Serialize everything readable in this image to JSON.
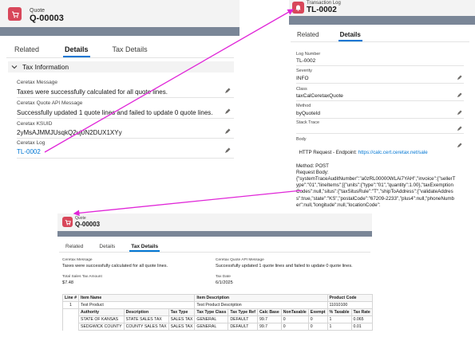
{
  "quote_panel": {
    "object_type": "Quote",
    "title": "Q-00003",
    "tabs": [
      "Related",
      "Details",
      "Tax Details"
    ],
    "active_tab": "Details",
    "section_title": "Tax Information",
    "fields": [
      {
        "label": "Ceretax Message",
        "value": "Taxes were successfully calculated for all quote lines."
      },
      {
        "label": "Ceretax Quote API Message",
        "value": "Successfully updated 1 quote lines and failed to update 0 quote lines."
      },
      {
        "label": "Ceretax KSUID",
        "value": "2yMsAJMMJUsqkQ2uj0N2DUX1XYy"
      },
      {
        "label": "Ceretax Log",
        "value": "TL-0002"
      }
    ]
  },
  "log_panel": {
    "object_type": "Transaction Log",
    "title": "TL-0002",
    "tabs": [
      "Related",
      "Details"
    ],
    "active_tab": "Details",
    "fields": [
      {
        "label": "Log Number",
        "value": "TL-0002"
      },
      {
        "label": "Severity",
        "value": "INFO"
      },
      {
        "label": "Class",
        "value": "taxCalCeretaxQuote"
      },
      {
        "label": "Method",
        "value": "byQuoteId"
      },
      {
        "label": "Stack Trace",
        "value": ""
      }
    ],
    "body_label": "Body",
    "body_endpoint_prefix": "HTTP Request - Endpoint: ",
    "body_endpoint_url": "https://calc.cert.ceretax.net/sale",
    "body_text": "Method: POST\nRequest Body:\n{\"systemTraceAuditNumber\":\"a0zRL00000WLAi7YAH\",\"invoice\":{\"sellerType\":\"01\",\"lineItems\":[{\"units\":{\"type\":\"01\",\"quantity\":1.00},\"taxExemptionCodes\":null,\"situs\":{\"taxSitusRule\":\"T\",\"shipToAddress\":{\"validateAddress\":true,\"state\":\"KS\",\"postalCode\":\"67209-2233\",\"plus4\":null,\"phoneNumber\":null,\"longitude\":null,\"locationCode\":"
  },
  "quote_panel_2": {
    "object_type": "Quote",
    "title": "Q-00003",
    "tabs": [
      "Related",
      "Details",
      "Tax Details"
    ],
    "active_tab": "Tax Details",
    "fields_left": [
      {
        "label": "Ceretax Message",
        "value": "Taxes were successfully calculated for all quote lines."
      },
      {
        "label": "Total Sales Tax Amount",
        "value": "$7.48"
      }
    ],
    "fields_right": [
      {
        "label": "Ceretax Quote API Message",
        "value": "Successfully updated 1 quote lines and failed to update 0 quote lines."
      },
      {
        "label": "Tax Date",
        "value": "6/1/2025"
      }
    ],
    "line_header": [
      "Line #",
      "Item Name",
      "Item Description",
      "Product Code"
    ],
    "line_row": [
      "1",
      "Test Product",
      "Test Product Description",
      "11010100"
    ],
    "tax_header": [
      "Authority",
      "Description",
      "Tax Type",
      "Tax Type Class",
      "Tax Type Ref",
      "Calc Base",
      "NonTaxable",
      "Exempt",
      "% Taxable",
      "Tax Rate"
    ],
    "tax_rows": [
      [
        "STATE OF KANSAS",
        "STATE SALES TAX",
        "SALES TAX",
        "GENERAL",
        "DEFAULT",
        "99.7",
        "0",
        "0",
        "1",
        "0.065"
      ],
      [
        "SEDGWICK COUNTY",
        "COUNTY SALES TAX",
        "SALES TAX",
        "GENERAL",
        "DEFAULT",
        "99.7",
        "0",
        "0",
        "1",
        "0.01"
      ]
    ]
  },
  "icons": {
    "quote": "quote-icon",
    "log": "bell-icon",
    "edit": "pencil-icon",
    "chevron": "chevron-down-icon"
  },
  "colors": {
    "link": "#0176d3",
    "arrow": "#e026d8",
    "icon_bg": "#d8475a",
    "tab_active": "#0176d3"
  }
}
